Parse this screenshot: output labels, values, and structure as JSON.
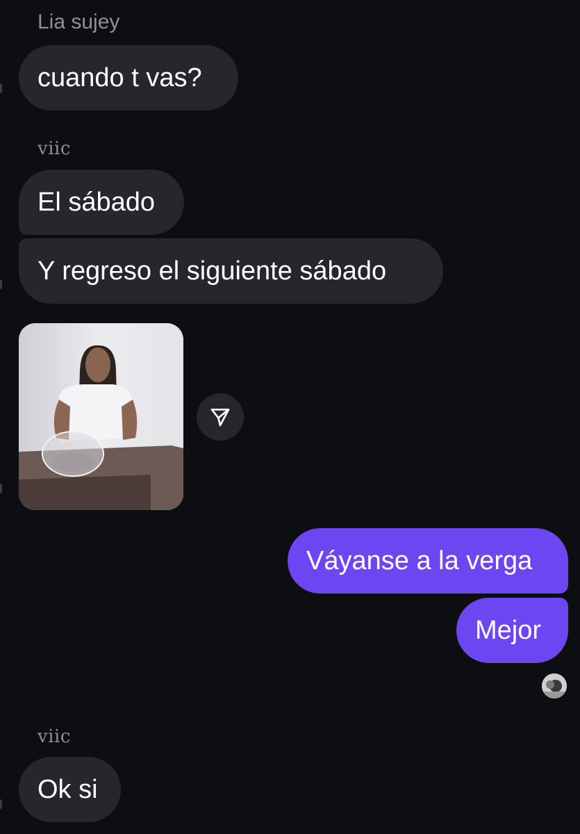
{
  "messages": [
    {
      "sender": "Lia sujey",
      "text": "cuando t vas?"
    },
    {
      "sender": "viic",
      "text": "El sábado"
    },
    {
      "text": "Y regreso el siguiente sábado"
    },
    {
      "type": "image",
      "icon": "media-thumbnail",
      "share_icon": "send-icon"
    },
    {
      "outgoing": true,
      "text": "Váyanse a la verga"
    },
    {
      "outgoing": true,
      "text": "Mejor",
      "seen_icon": "seen-avatar"
    },
    {
      "sender": "viic",
      "text": "Ok si"
    }
  ],
  "colors": {
    "background": "#0c0e12",
    "incoming_bubble": "#25272b",
    "outgoing_bubble": "#6c46f0",
    "sender_name": "#8d9096"
  }
}
